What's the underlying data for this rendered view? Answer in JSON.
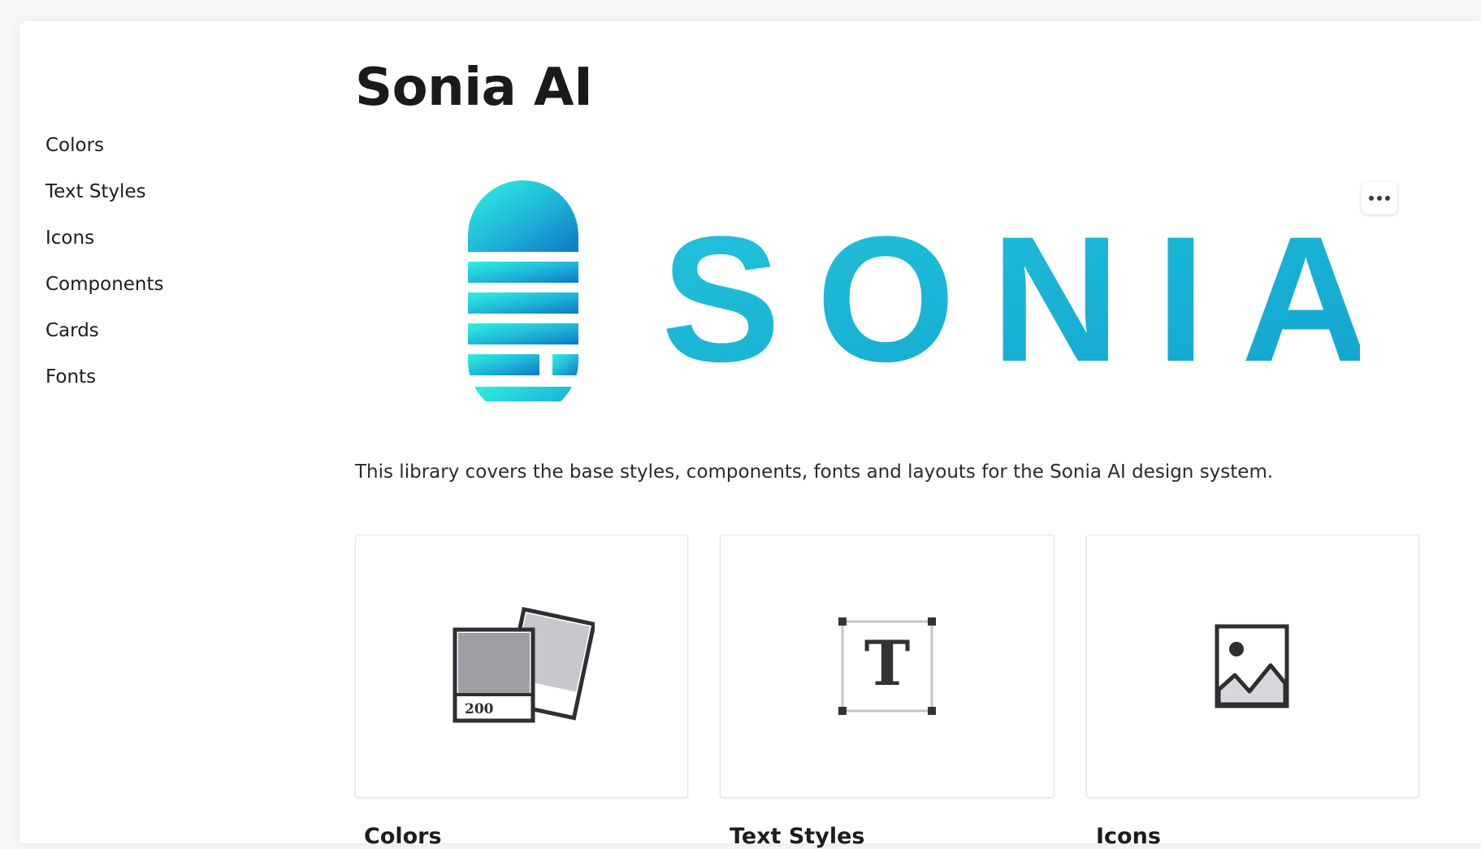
{
  "page": {
    "title": "Sonia AI",
    "description": "This library covers the base styles, components, fonts and layouts for the Sonia AI design system."
  },
  "sidebar": {
    "items": [
      {
        "label": "Colors"
      },
      {
        "label": "Text Styles"
      },
      {
        "label": "Icons"
      },
      {
        "label": "Components"
      },
      {
        "label": "Cards"
      },
      {
        "label": "Fonts"
      }
    ]
  },
  "logo": {
    "wordmark": "SONIA",
    "gradient_start": "#2ef2e0",
    "gradient_mid": "#1fb3d8",
    "gradient_end": "#0d79c4"
  },
  "more_menu": {
    "icon": "more-horizontal-icon"
  },
  "cards": [
    {
      "label": "Colors",
      "icon": "color-swatches-icon",
      "swatch_label": "200"
    },
    {
      "label": "Text Styles",
      "icon": "text-style-icon",
      "glyph": "T"
    },
    {
      "label": "Icons",
      "icon": "image-icon"
    }
  ]
}
